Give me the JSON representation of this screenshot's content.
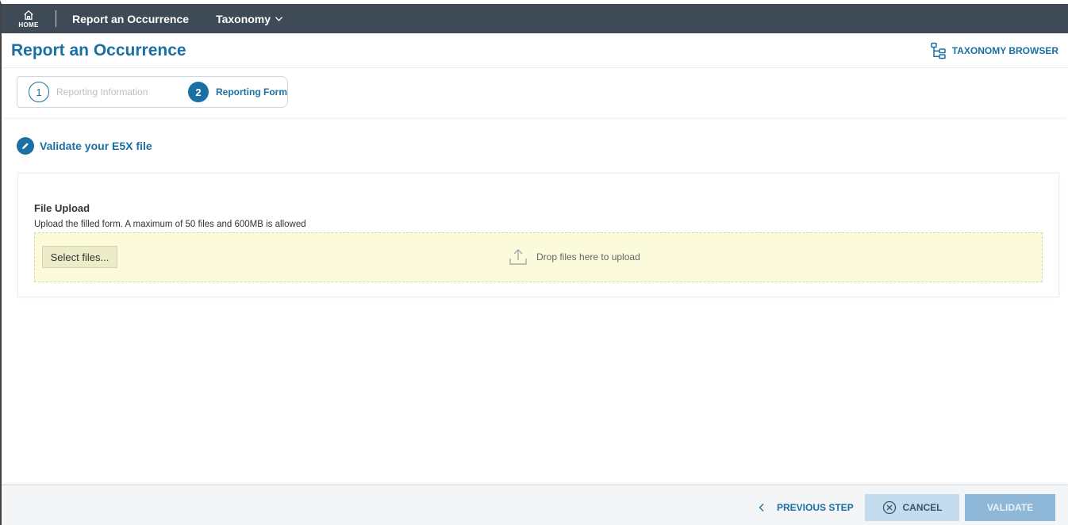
{
  "topnav": {
    "home_label": "HOME",
    "items": [
      {
        "label": "Report an Occurrence"
      },
      {
        "label": "Taxonomy"
      }
    ]
  },
  "header": {
    "title": "Report an Occurrence",
    "taxonomy_browser_label": "TAXONOMY BROWSER"
  },
  "stepper": {
    "steps": [
      {
        "number": "1",
        "label": "Reporting Information",
        "state": "completed"
      },
      {
        "number": "2",
        "label": "Reporting Form",
        "state": "active"
      }
    ]
  },
  "section": {
    "title": "Validate your E5X file"
  },
  "upload": {
    "title": "File Upload",
    "description": "Upload the filled form. A maximum of 50 files and 600MB is allowed",
    "select_label": "Select files...",
    "drop_hint": "Drop files here to upload"
  },
  "footer": {
    "previous_label": "PREVIOUS STEP",
    "cancel_label": "CANCEL",
    "validate_label": "VALIDATE"
  },
  "colors": {
    "nav_bg": "#3e4a55",
    "accent": "#1a6fa3",
    "dropzone_bg": "#fbfbdc",
    "cancel_bg": "#c5dcee",
    "validate_bg": "#8fb8d8"
  },
  "icons": {
    "home": "home-icon",
    "taxonomy_dropdown": "chevron-down-icon",
    "taxonomy_browser": "tree-icon",
    "section": "pencil-icon",
    "upload": "upload-icon",
    "previous": "chevron-left-icon",
    "cancel": "close-circle-icon"
  }
}
